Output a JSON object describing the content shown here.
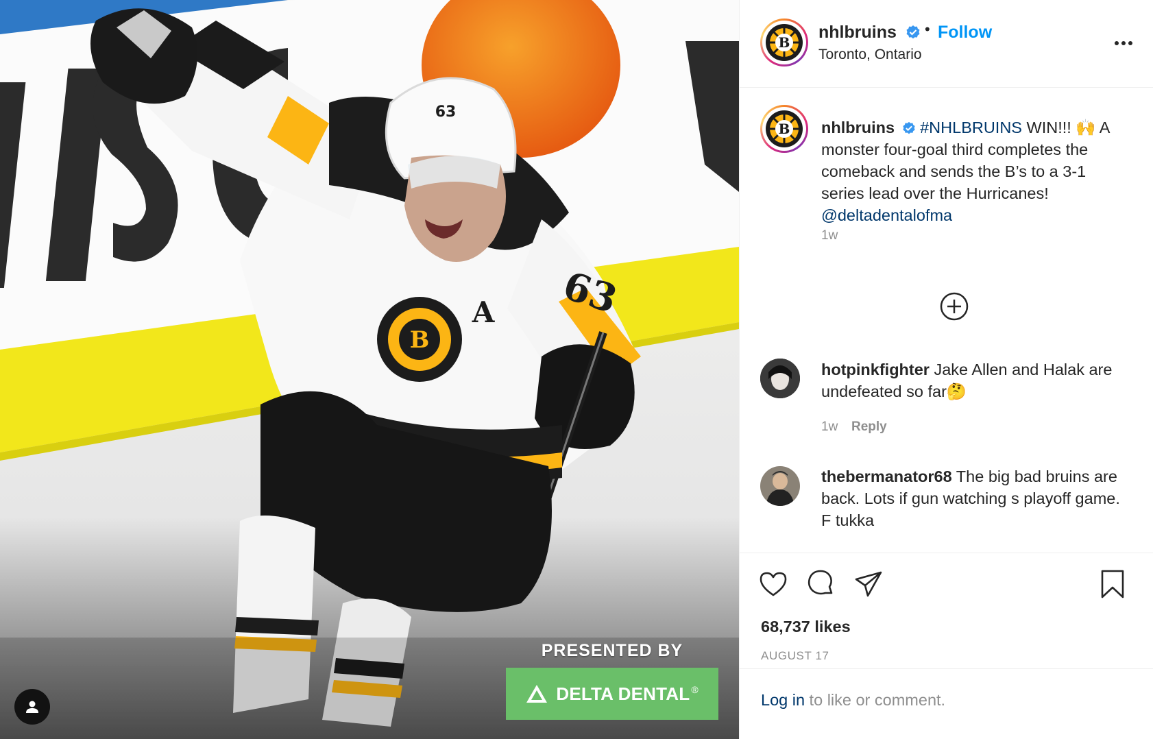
{
  "post": {
    "sponsor_heading": "PRESENTED BY",
    "sponsor_name": "DELTA DENTAL",
    "sponsor_mark": "®",
    "jersey_number": "63",
    "jersey_letter": "A",
    "board_letters": "DISCOV"
  },
  "header": {
    "username": "nhlbruins",
    "separator": "•",
    "follow_label": "Follow",
    "location": "Toronto, Ontario",
    "more_icon": "more-options-icon"
  },
  "caption": {
    "username": "nhlbruins",
    "hashtag": "#NHLBRUINS",
    "text_part1": " WIN!!! 🙌 A monster four-goal third completes the comeback and sends the B’s to a 3-1 series lead over the Hurricanes! ",
    "mention": "@deltadentalofma",
    "age": "1w"
  },
  "comments": [
    {
      "username": "hotpinkfighter",
      "text": " Jake Allen and Halak are undefeated so far🤔",
      "age": "1w",
      "reply_label": "Reply"
    },
    {
      "username": "thebermanator68",
      "text": " The big bad bruins are back. Lots if gun watching s playoff game. F tukka"
    }
  ],
  "actions": {
    "likes": "68,737 likes",
    "date": "AUGUST 17"
  },
  "login": {
    "link": "Log in",
    "rest": " to like or comment."
  },
  "colors": {
    "follow": "#0095f6",
    "link": "#00376b",
    "muted": "#8e8e8e",
    "sponsor_green": "#6abf69",
    "bruins_gold": "#fcb514"
  }
}
